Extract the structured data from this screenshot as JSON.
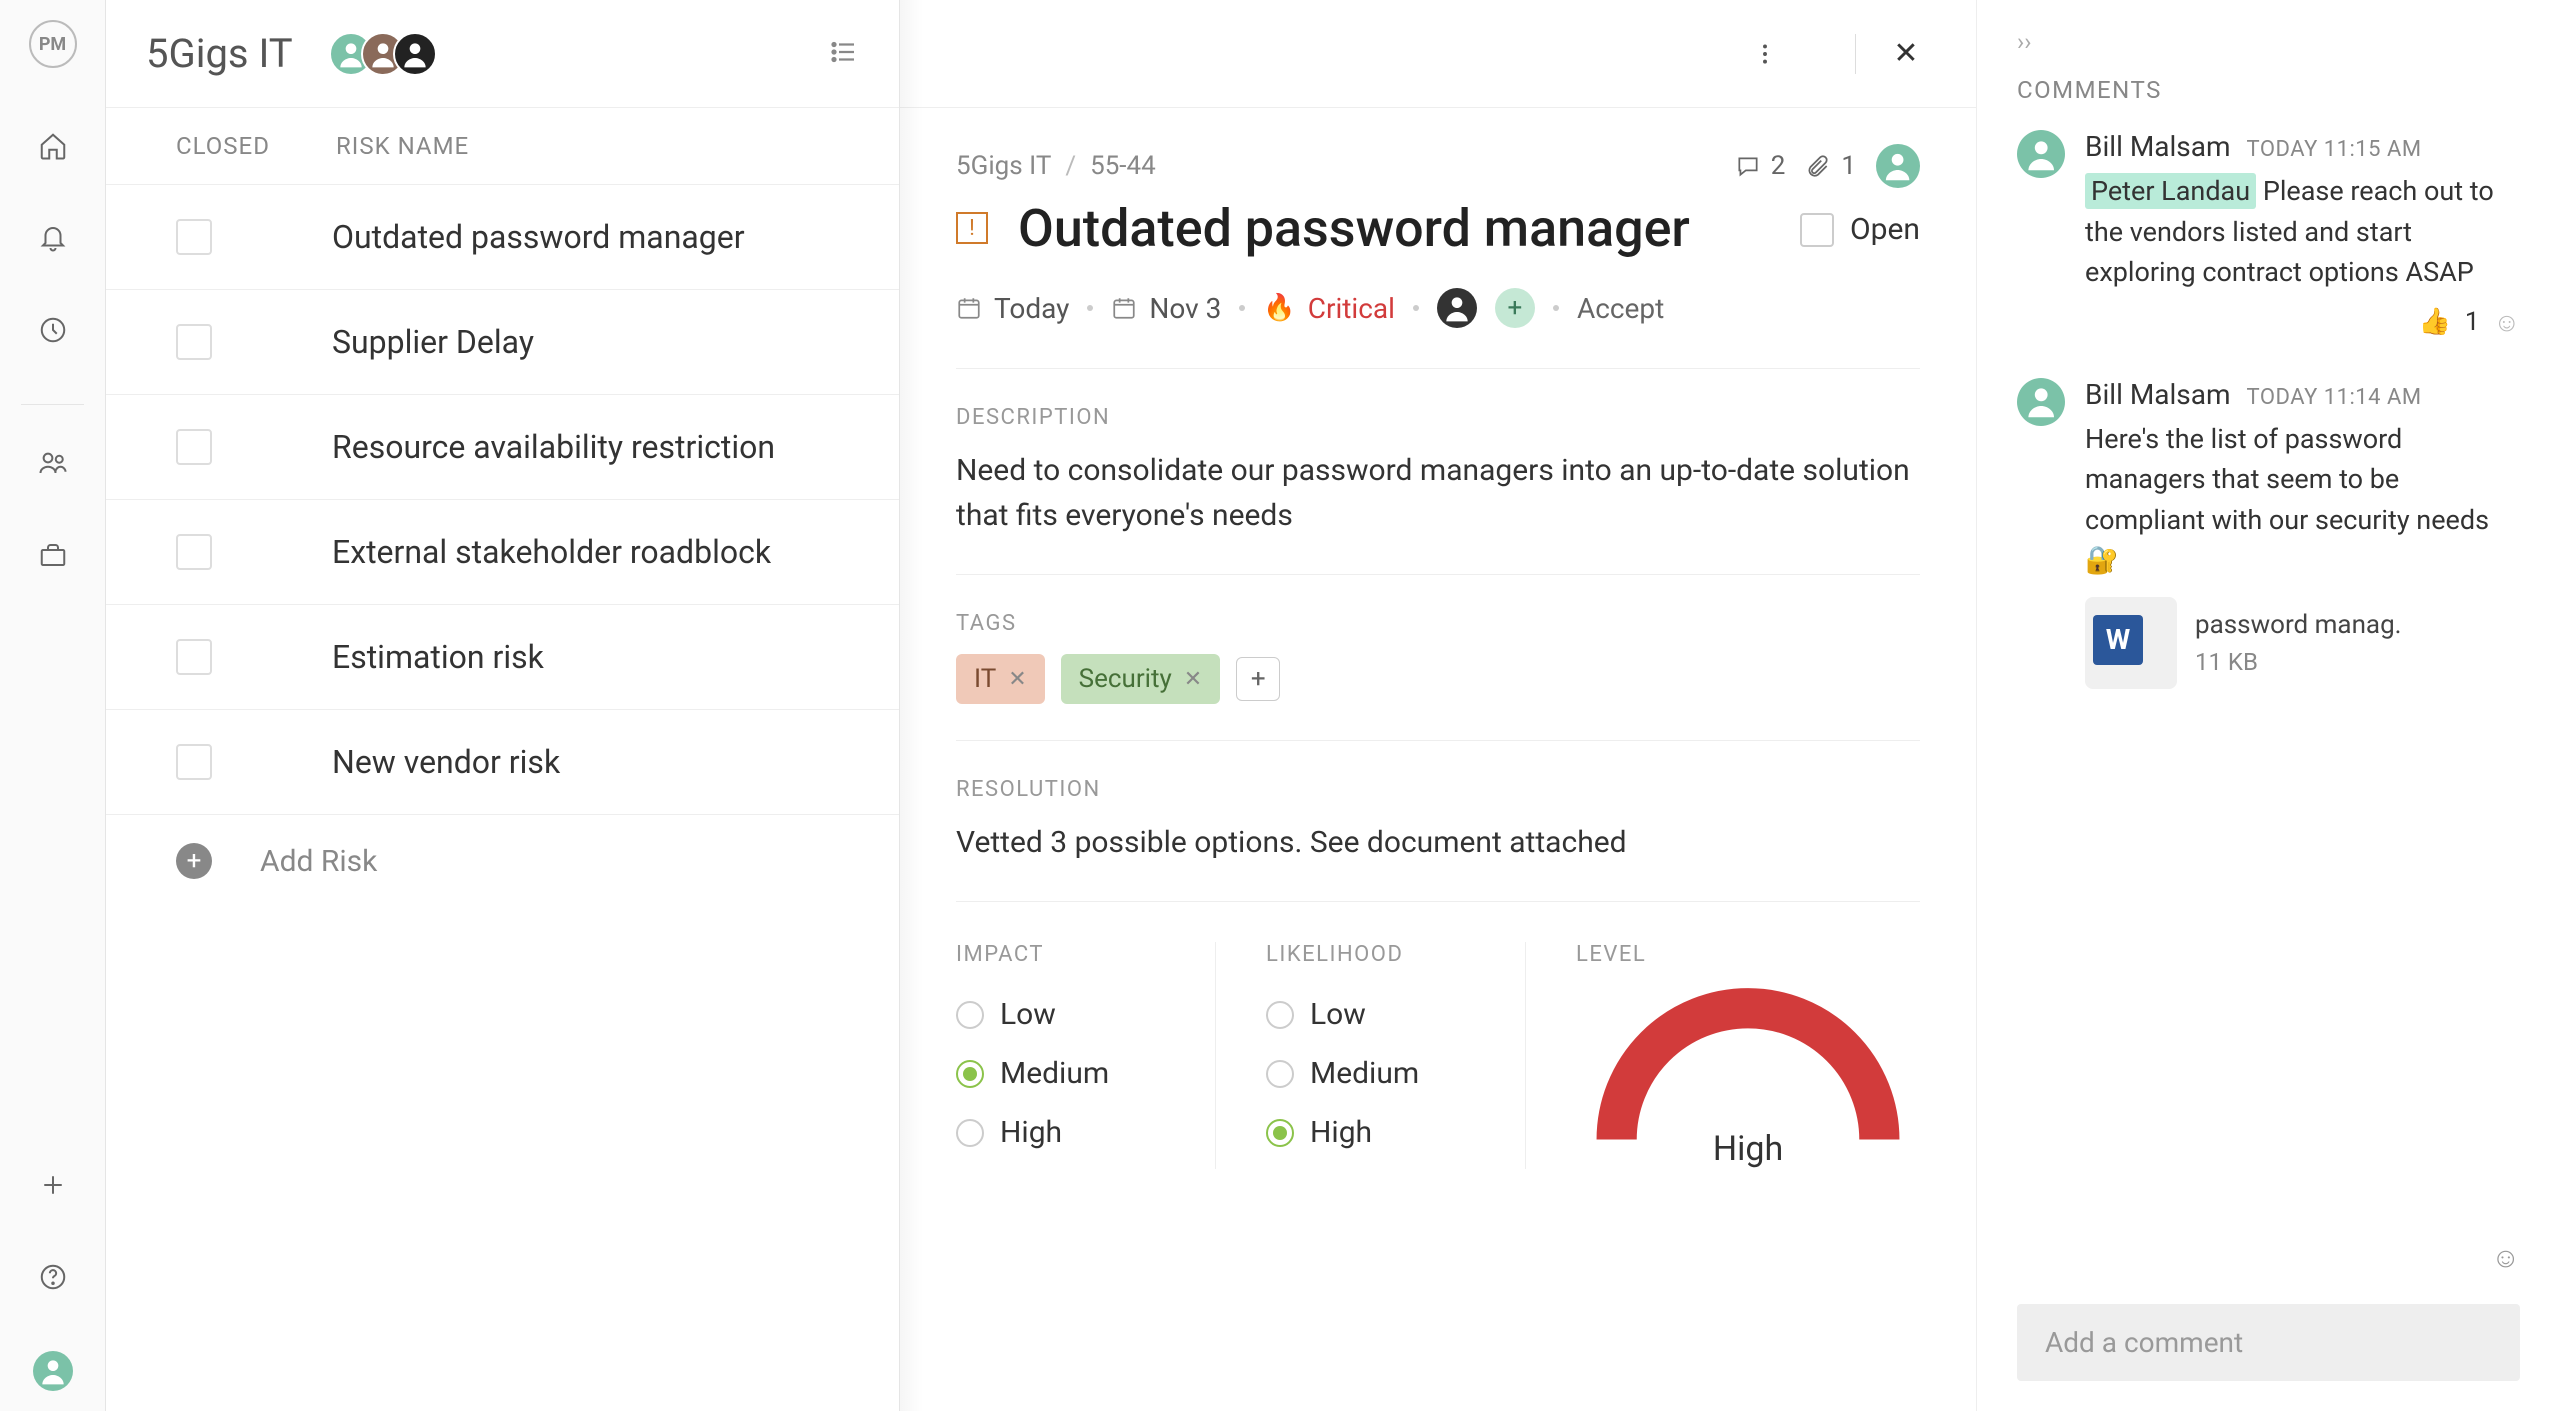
{
  "rail": {
    "logo": "PM"
  },
  "header": {
    "project_title": "5Gigs IT"
  },
  "list": {
    "col_closed": "CLOSED",
    "col_name": "RISK NAME",
    "add_label": "Add Risk",
    "rows": [
      {
        "name": "Outdated password manager"
      },
      {
        "name": "Supplier Delay"
      },
      {
        "name": "Resource availability restriction"
      },
      {
        "name": "External stakeholder roadblock"
      },
      {
        "name": "Estimation risk"
      },
      {
        "name": "New vendor risk"
      }
    ]
  },
  "detail": {
    "breadcrumb_project": "5Gigs IT",
    "breadcrumb_id": "55-44",
    "comment_count": "2",
    "attach_count": "1",
    "title": "Outdated password manager",
    "status": "Open",
    "date_created": "Today",
    "date_due": "Nov 3",
    "priority": "Critical",
    "response": "Accept",
    "description_label": "DESCRIPTION",
    "description": "Need to consolidate our password managers into an up-to-date solution that fits everyone's needs",
    "tags_label": "TAGS",
    "tags": {
      "it": "IT",
      "security": "Security"
    },
    "resolution_label": "RESOLUTION",
    "resolution": "Vetted 3 possible options. See document attached",
    "impact_label": "IMPACT",
    "likelihood_label": "LIKELIHOOD",
    "level_label": "LEVEL",
    "opt_low": "Low",
    "opt_medium": "Medium",
    "opt_high": "High",
    "impact_value": "Medium",
    "likelihood_value": "High",
    "level_value": "High"
  },
  "comments": {
    "title": "COMMENTS",
    "items": [
      {
        "author": "Bill Malsam",
        "time": "TODAY 11:15 AM",
        "mention": "Peter Landau",
        "body": " Please reach out to the vendors listed and start exploring contract options ASAP",
        "reaction_emoji": "👍",
        "reaction_count": "1"
      },
      {
        "author": "Bill Malsam",
        "time": "TODAY 11:14 AM",
        "body": "Here's the list of password managers that seem to be compliant with our security needs 🔐",
        "attachment_name": "password manag.",
        "attachment_size": "11 KB"
      }
    ],
    "input_placeholder": "Add a comment"
  }
}
